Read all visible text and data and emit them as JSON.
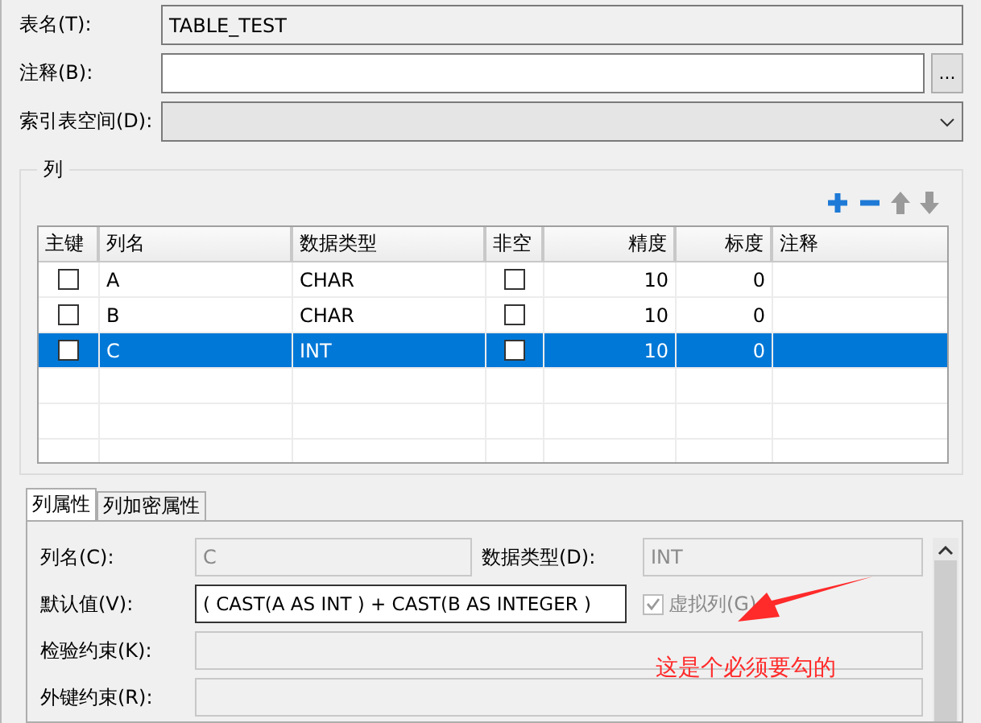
{
  "fields": [
    {
      "label": "表名(T):",
      "kind": "readonly",
      "value": "TABLE_TEST"
    },
    {
      "label": "注释(B):",
      "kind": "browse",
      "button": "..."
    },
    {
      "label": "索引表空间(D):",
      "kind": "dropdown"
    }
  ],
  "columns_group": {
    "title": "列",
    "table": {
      "columns": [
        "主键",
        "列名",
        "数据类型",
        "非空",
        "精度",
        "标度",
        "注释"
      ],
      "rows": [
        {
          "primary_key": false,
          "name": "A",
          "type": "CHAR",
          "not_null": false,
          "precision": "10",
          "scale": "0",
          "selected": false
        },
        {
          "primary_key": false,
          "name": "B",
          "type": "CHAR",
          "not_null": false,
          "precision": "10",
          "scale": "0",
          "selected": false
        },
        {
          "primary_key": false,
          "name": "C",
          "type": "INT",
          "not_null": false,
          "precision": "10",
          "scale": "0",
          "selected": true
        }
      ]
    }
  },
  "tabs": [
    {
      "label": "列属性",
      "selected": true
    },
    {
      "label": "列加密属性",
      "selected": false
    }
  ],
  "properties": {
    "name": {
      "label": "列名(C):",
      "value": "C"
    },
    "type": {
      "label": "数据类型(D):",
      "value": "INT"
    },
    "default": {
      "label": "默认值(V):",
      "value": "( CAST(A AS  INT )  +  CAST(B AS INTEGER )"
    },
    "virtual": {
      "label": "虚拟列(G)",
      "checked": true,
      "disabled": true
    },
    "check_constraint": {
      "label": "检验约束(K):"
    },
    "foreign_key": {
      "label": "外键约束(R):"
    }
  },
  "annotation": {
    "text": "这是个必须要勾的"
  }
}
